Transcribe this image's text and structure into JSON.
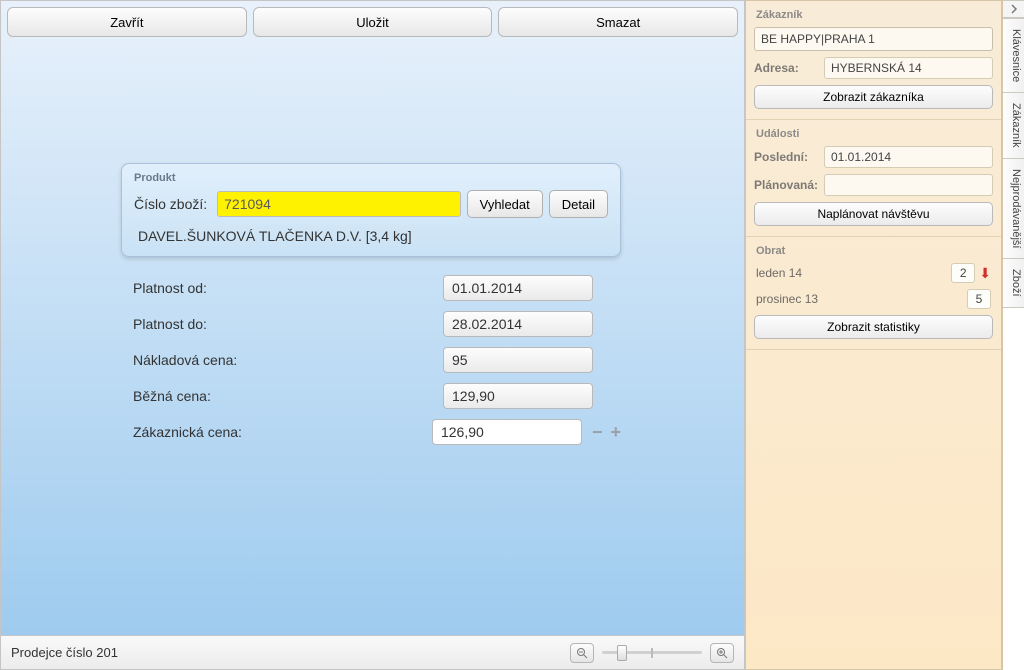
{
  "toolbar": {
    "close": "Zavřít",
    "save": "Uložit",
    "delete": "Smazat"
  },
  "product": {
    "box_title": "Produkt",
    "code_label": "Číslo zboží:",
    "code": "721094",
    "search_btn": "Vyhledat",
    "detail_btn": "Detail",
    "description": "DAVEL.ŠUNKOVÁ TLAČENKA D.V. [3,4 kg]"
  },
  "fields": {
    "valid_from_label": "Platnost od:",
    "valid_from": "01.01.2014",
    "valid_to_label": "Platnost do:",
    "valid_to": "28.02.2014",
    "cost_label": "Nákladová cena:",
    "cost": "95",
    "normal_label": "Běžná cena:",
    "normal": "129,90",
    "customer_label": "Zákaznická cena:",
    "customer": "126,90"
  },
  "status": "Prodejce číslo 201",
  "side": {
    "customer_title": "Zákazník",
    "customer_name": "BE HAPPY|PRAHA 1",
    "address_label": "Adresa:",
    "address": "HYBERNSKÁ 14",
    "show_customer": "Zobrazit zákazníka",
    "events_title": "Události",
    "last_label": "Poslední:",
    "last_value": "01.01.2014",
    "planned_label": "Plánovaná:",
    "planned_value": "",
    "plan_visit": "Naplánovat návštěvu",
    "turnover_title": "Obrat",
    "turnover": [
      {
        "label": "leden 14",
        "value": "2",
        "trend": "down"
      },
      {
        "label": "prosinec 13",
        "value": "5",
        "trend": ""
      }
    ],
    "show_stats": "Zobrazit statistiky"
  },
  "vtabs": [
    "Klávesnice",
    "Zákazník",
    "Nejprodávanější",
    "Zboží"
  ]
}
